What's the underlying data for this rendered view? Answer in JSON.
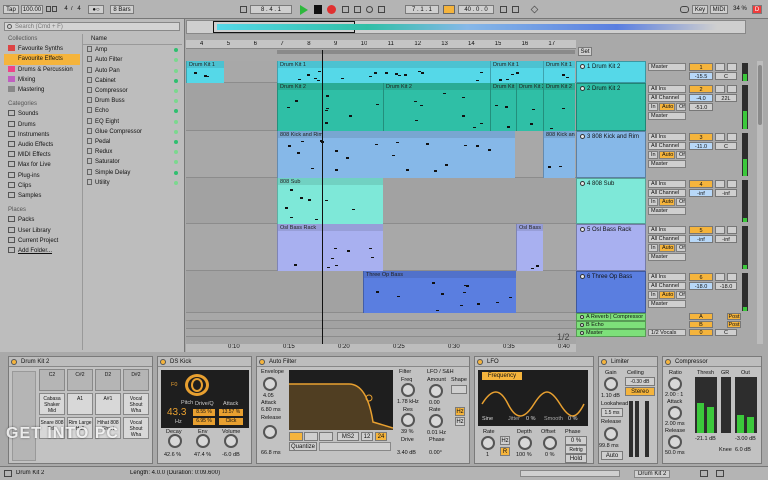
{
  "transport": {
    "tap": "Tap",
    "bpm": "100.00",
    "sig_num": "4",
    "sig_den": "4",
    "metro": "●○",
    "quant": "8 Bars",
    "pos": "8 . 4 . 1",
    "loop_start": "7 . 1 . 1",
    "loop_len": "40 . 0 . 0",
    "key": "Key",
    "midi": "MIDI",
    "cpu": "34 %",
    "d_label": "D"
  },
  "browser": {
    "search_placeholder": "Search (Cmd + F)",
    "collections_title": "Collections",
    "collections": [
      "Favourite Synths",
      "Favourite Effects",
      "Drums & Percussion",
      "Mixing",
      "Mastering"
    ],
    "categories_title": "Categories",
    "categories": [
      "Sounds",
      "Drums",
      "Instruments",
      "Audio Effects",
      "MIDI Effects",
      "Max for Live",
      "Plug-ins",
      "Clips",
      "Samples"
    ],
    "places_title": "Places",
    "places": [
      "Packs",
      "User Library",
      "Current Project",
      "Add Folder..."
    ],
    "name_header": "Name",
    "items": [
      "Amp",
      "Auto Filter",
      "Auto Pan",
      "Cabinet",
      "Compressor",
      "Drum Buss",
      "Echo",
      "EQ Eight",
      "Glue Compressor",
      "Pedal",
      "Redux",
      "Saturator",
      "Simple Delay",
      "Utility"
    ],
    "colors": {
      "synths": "#d44",
      "effects": "#f5b43c",
      "drums": "#e48",
      "mixing": "#c060c0",
      "mastering": "#888"
    }
  },
  "ruler": [
    "4",
    "5",
    "6",
    "7",
    "8",
    "9",
    "10",
    "11",
    "12",
    "13",
    "14",
    "15",
    "16",
    "17"
  ],
  "set_label": "Set",
  "tracks": [
    {
      "name": "1 Drum Kit 2",
      "color": "#55d8e8",
      "io1": "Master",
      "vol_num": "1",
      "vol": "-15.5",
      "pan": "C"
    },
    {
      "name": "2 Drum Kit 2",
      "color": "#2fbfa6",
      "io1": "All Ins",
      "io2": "All Channel",
      "mon_in": "In",
      "mon_auto": "Auto",
      "mon_off": "Off",
      "io3": "Master",
      "vol_num": "2",
      "vol": "-4.0",
      "pan": "22L",
      "send": "-51.0"
    },
    {
      "name": "3 808 Kick and Rim",
      "color": "#86b8e8",
      "io1": "All Ins",
      "io2": "All Channel",
      "mon_in": "In",
      "mon_auto": "Auto",
      "mon_off": "Off",
      "io3": "Master",
      "vol_num": "3",
      "vol": "-11.0",
      "pan": "C"
    },
    {
      "name": "4 808 Sub",
      "color": "#7ee8d8",
      "io1": "All Ins",
      "io2": "All Channel",
      "mon_in": "In",
      "mon_auto": "Auto",
      "mon_off": "Off",
      "io3": "Master",
      "vol_num": "4",
      "vol": "-inf",
      "pan": "-inf"
    },
    {
      "name": "5 Osl Bass Rack",
      "color": "#a8b0f0",
      "io1": "All Ins",
      "io2": "All Channel",
      "mon_in": "In",
      "mon_auto": "Auto",
      "mon_off": "Off",
      "io3": "Master",
      "vol_num": "5",
      "vol": "-inf",
      "pan": "-inf"
    },
    {
      "name": "6 Three Op Bass",
      "color": "#5a7ee0",
      "io1": "All Ins",
      "io2": "All Channel",
      "mon_in": "In",
      "mon_auto": "Auto",
      "mon_off": "Off",
      "io3": "Master",
      "vol_num": "6",
      "vol": "-18.0",
      "pan": "-18.0"
    }
  ],
  "returns": [
    {
      "name": "A Reverb | Compressor",
      "color": "#7de07a",
      "vol_num": "A",
      "post": "Post"
    },
    {
      "name": "B Echo",
      "color": "#7de07a",
      "vol_num": "B",
      "post": "Post"
    },
    {
      "name": "Master",
      "color": "#7de07a",
      "io1": "1/2 Vocals",
      "vol_num": "0",
      "pan": "C"
    }
  ],
  "clips": {
    "t1": [
      "Drum Kit 1",
      "Drum Kit 1",
      "Drum Kit 1",
      "Drum Kit 1"
    ],
    "t2": [
      "Drum Kit 2",
      "Drum Kit 2",
      "Drum Kit 2",
      "Drum Kit 2",
      "Drum Kit 2"
    ],
    "t3": [
      "808 Kick and Rim",
      "808 Kick and Rim"
    ],
    "t4": [
      "808 Sub"
    ],
    "t5": [
      "Osl Bass Rack",
      "Osl Bass Rack"
    ],
    "t6": [
      "Three Op Bass"
    ]
  },
  "time_ruler": [
    "0:10",
    "0:15",
    "0:20",
    "0:25",
    "0:30",
    "0:35",
    "0:40"
  ],
  "page_indicator": "1/2",
  "devices": {
    "drumrack": {
      "title": "Drum Kit 2",
      "pads": [
        "C2",
        "C#2",
        "D2",
        "D#2",
        "Cabasa Shaker Mid",
        "A1",
        "A#1",
        "Vocal Shout Wha",
        "Snare 808 Title",
        "Rim Large Hall",
        "Hihat 808 Short",
        "Vocal Shout Wha"
      ],
      "pad_labels": [
        "G1",
        "G1"
      ]
    },
    "kick": {
      "title": "DS Kick",
      "pitch_label": "Pitch",
      "pitch": "43.3",
      "pitch_unit": "Hz",
      "f0": "F0",
      "drive_label": "Drive/Q",
      "drive": "3.45 %",
      "attack_label": "Attack",
      "attack": "13.57 %",
      "decay_label": "Decay",
      "decay": "42.6 %",
      "env_label": "Env",
      "env": "47.4 %",
      "volume_label": "Volume",
      "volume": "-6.0 dB",
      "click": "Click",
      "v1": "8.55 %",
      "v2": "6.95 %"
    },
    "autofilter": {
      "title": "Auto Filter",
      "envelope": "Envelope",
      "env_val": "4.05",
      "attack": "Attack",
      "attack_val": "6.80 ms",
      "release": "Release",
      "release_val": "66.8 ms",
      "filter": "Filter",
      "freq": "Freq",
      "freq_val": "1.78 kHz",
      "res": "Res",
      "res_val": "39 %",
      "drive": "Drive",
      "drive_val": "3.40 dB",
      "lfo": "LFO / S&H",
      "amount": "Amount",
      "amount_val": "0.00",
      "rate": "Rate",
      "rate_val": "0.01 Hz",
      "phase": "Phase",
      "phase_val": "0.00°",
      "shape": "Shape",
      "quantize": "Quantize",
      "ms2": "MS2",
      "q12": "12",
      "q24": "24",
      "hz": "Hz",
      "hz2": "Hz"
    },
    "lfo": {
      "title": "LFO",
      "target": "Frequency",
      "wave": "Sine",
      "jitter": "Jitter",
      "jitter_val": "0 %",
      "smooth": "Smooth",
      "smooth_val": "0 %",
      "rate": "Rate",
      "rate_val": "1",
      "depth": "Depth",
      "depth_val": "100 %",
      "offset": "Offset",
      "offset_val": "0 %",
      "phase": "Phase",
      "phase_val": "0 %",
      "hold": "Hold",
      "r": "R",
      "lhz": "Hz",
      "retrig": "Retrig"
    },
    "limiter": {
      "title": "Limiter",
      "gain": "Gain",
      "gain_val": "1.10 dB",
      "ceiling": "Ceiling",
      "ceiling_val": "-0.30 dB",
      "stereo": "Stereo",
      "lookahead": "Lookahead",
      "lookahead_val": "1.5 ms",
      "release": "Release",
      "release_val": "99.8 ms",
      "auto": "Auto"
    },
    "compressor": {
      "title": "Compressor",
      "ratio": "Ratio",
      "ratio_val": "2.00 : 1",
      "attack": "Attack",
      "attack_val": "2.00 ms",
      "release": "Release",
      "release_val": "50.0 ms",
      "thresh": "Thresh",
      "gr": "GR",
      "out": "Out",
      "thresh_val": "-21.1 dB",
      "out_val": "-3.00 dB",
      "knee": "Knee",
      "knee_val": "6.0 dB"
    }
  },
  "status": {
    "left": "Drum Kit 2",
    "info": "Length: 4.0.0  (Duration: 0:09.600)",
    "right": "Drum Kit 2"
  },
  "watermark": "GET INTO PC"
}
